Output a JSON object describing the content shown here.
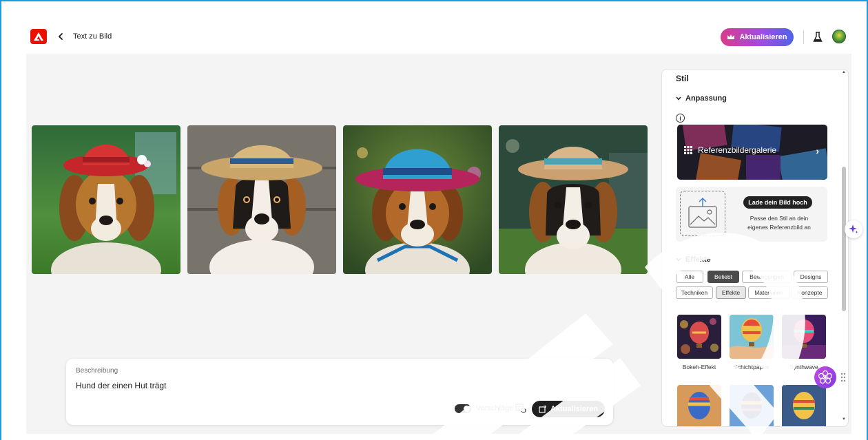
{
  "header": {
    "back_icon": "chevron-left-icon",
    "title": "Text zu Bild",
    "upgrade_label": "Aktualisieren",
    "upgrade_icon": "crown-icon",
    "labs_icon": "flask-icon",
    "logo_icon": "adobe-logo-icon"
  },
  "colors": {
    "frame_accent": "#1b9be0",
    "logo_red": "#eb1000",
    "upgrade_gradient_start": "#d93c8a",
    "upgrade_gradient_end": "#4f63e8",
    "dark_button": "#1f1f1f"
  },
  "results": {
    "images": [
      {
        "subject": "beagle with red hat"
      },
      {
        "subject": "beagle with straw hat"
      },
      {
        "subject": "beagle with blue hat"
      },
      {
        "subject": "puppy with straw hat"
      }
    ]
  },
  "prompt": {
    "label": "Beschreibung",
    "text": "Hund der einen Hut trägt",
    "suggestions_label": "Vorschläge",
    "suggestions_on": true,
    "generate_label": "Aktualisieren"
  },
  "panel": {
    "title": "Stil",
    "customization_title": "Anpassung",
    "gallery_label": "Referenzbildergalerie",
    "upload_button": "Lade dein Bild hoch",
    "upload_desc": "Passe den Stil an dein eigenes Referenzbild an",
    "effects_title": "Effekte",
    "chips_row1": [
      "Alle",
      "Beliebt",
      "Bewegungen",
      "Designs"
    ],
    "chips_row2": [
      "Techniken",
      "Effekte",
      "Materialien",
      "Konzepte"
    ],
    "effects": [
      {
        "label": "Bokeh-Effekt"
      },
      {
        "label": "Schichtpapier"
      },
      {
        "label": "Synthwave"
      }
    ]
  }
}
